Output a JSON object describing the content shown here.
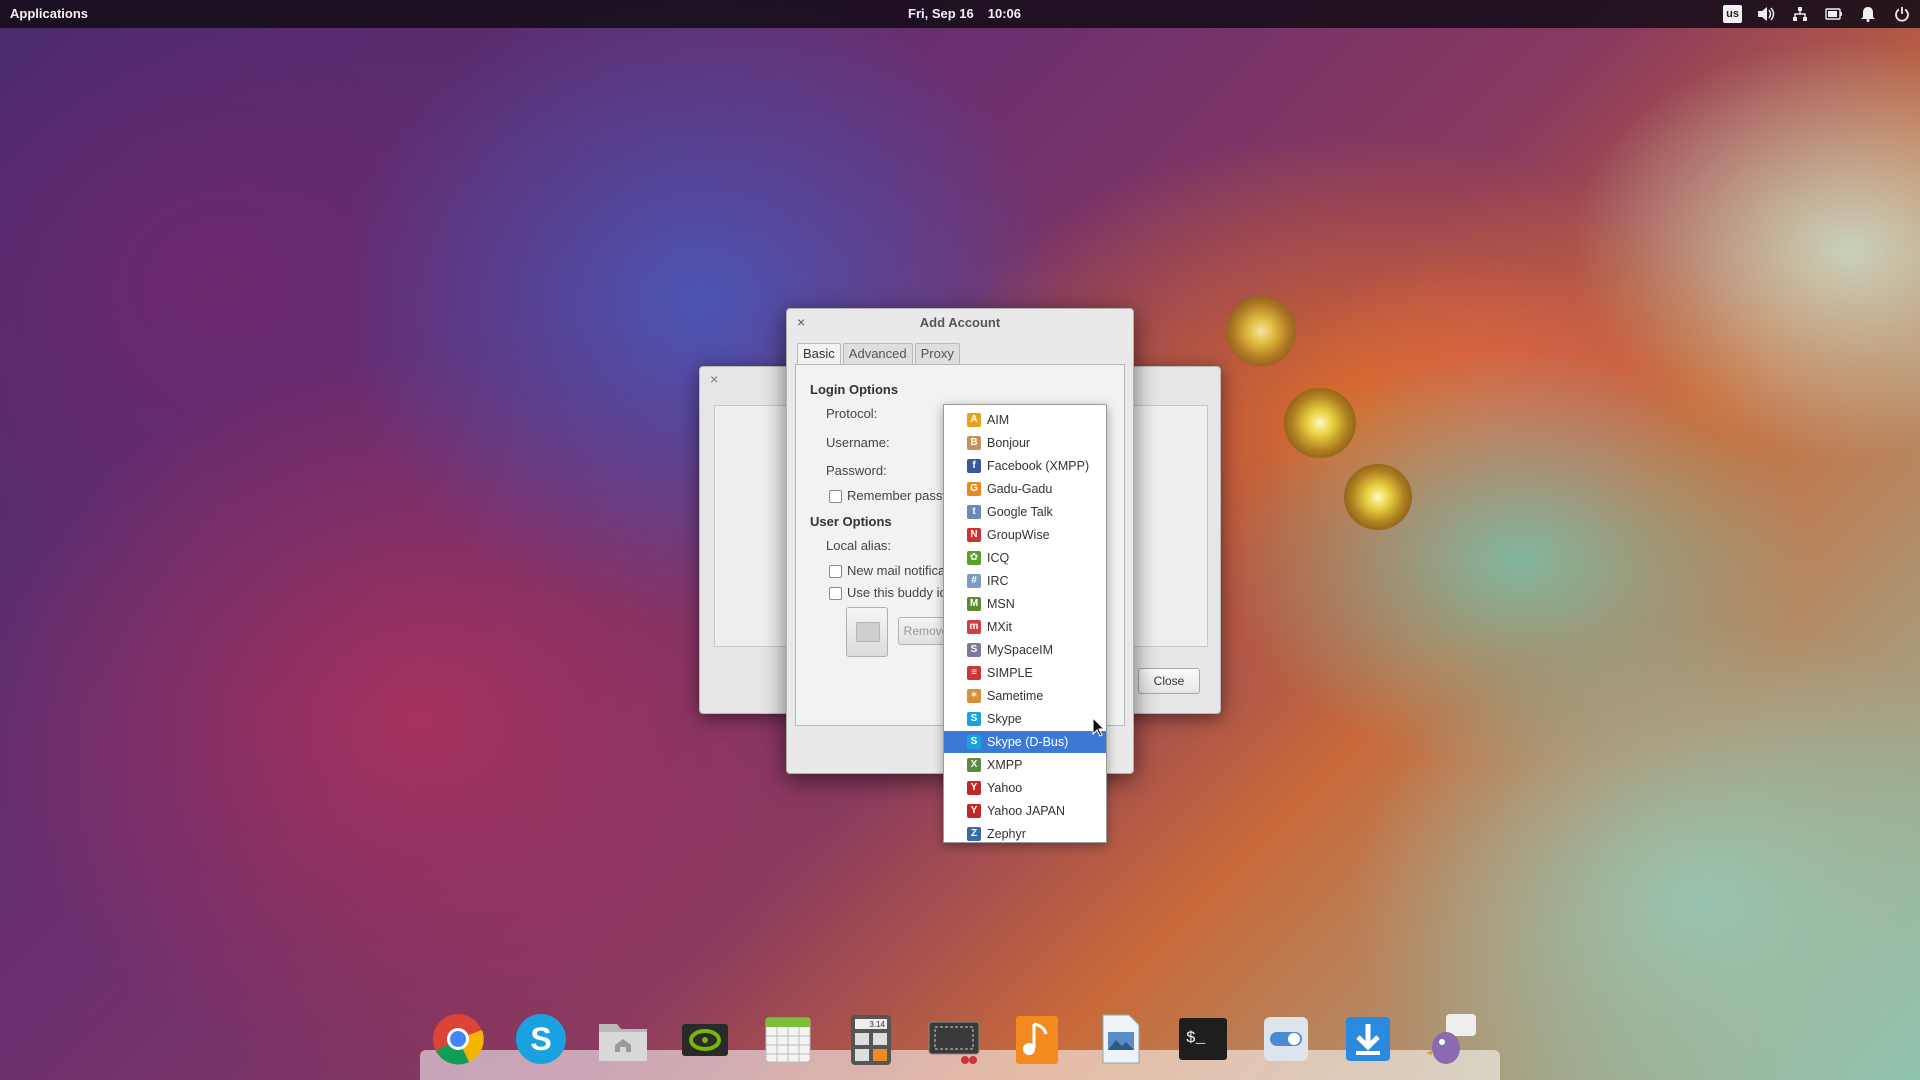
{
  "top_panel": {
    "applications_label": "Applications",
    "date": "Fri, Sep 16",
    "time": "10:06",
    "keyboard_layout": "us",
    "tray_icons": [
      "volume-icon",
      "network-icon",
      "battery-icon",
      "notifications-icon",
      "power-icon"
    ]
  },
  "background_dialog": {
    "close_glyph": "×",
    "remove_label": "Remove",
    "close_label": "Close"
  },
  "add_account": {
    "title": "Add Account",
    "close_glyph": "×",
    "tabs": [
      {
        "label": "Basic",
        "active": true
      },
      {
        "label": "Advanced",
        "active": false
      },
      {
        "label": "Proxy",
        "active": false
      }
    ],
    "login_options_title": "Login Options",
    "protocol_label": "Protocol:",
    "username_label": "Username:",
    "password_label": "Password:",
    "remember_password_label": "Remember passw",
    "user_options_title": "User Options",
    "local_alias_label": "Local alias:",
    "new_mail_label": "New mail notifica",
    "buddy_icon_label": "Use this buddy ic"
  },
  "protocol_dropdown": {
    "items": [
      {
        "label": "AIM",
        "icon": "aim-icon",
        "color": "#e8a020",
        "glyph": "A"
      },
      {
        "label": "Bonjour",
        "icon": "bonjour-icon",
        "color": "#c8905a",
        "glyph": "B"
      },
      {
        "label": "Facebook (XMPP)",
        "icon": "facebook-icon",
        "color": "#3b5998",
        "glyph": "f"
      },
      {
        "label": "Gadu-Gadu",
        "icon": "gadu-gadu-icon",
        "color": "#e88820",
        "glyph": "G"
      },
      {
        "label": "Google Talk",
        "icon": "google-talk-icon",
        "color": "#6a8ab8",
        "glyph": "t"
      },
      {
        "label": "GroupWise",
        "icon": "groupwise-icon",
        "color": "#d03030",
        "glyph": "N"
      },
      {
        "label": "ICQ",
        "icon": "icq-icon",
        "color": "#58a028",
        "glyph": "✿"
      },
      {
        "label": "IRC",
        "icon": "irc-icon",
        "color": "#7a9ac8",
        "glyph": "#"
      },
      {
        "label": "MSN",
        "icon": "msn-icon",
        "color": "#5a8a30",
        "glyph": "M"
      },
      {
        "label": "MXit",
        "icon": "mxit-icon",
        "color": "#d04040",
        "glyph": "m"
      },
      {
        "label": "MySpaceIM",
        "icon": "myspaceim-icon",
        "color": "#7a7a9a",
        "glyph": "S"
      },
      {
        "label": "SIMPLE",
        "icon": "simple-icon",
        "color": "#c83838",
        "glyph": "≡"
      },
      {
        "label": "Sametime",
        "icon": "sametime-icon",
        "color": "#d89038",
        "glyph": "✶"
      },
      {
        "label": "Skype",
        "icon": "skype-icon",
        "color": "#1aa2e0",
        "glyph": "S"
      },
      {
        "label": "Skype (D-Bus)",
        "icon": "skype-dbus-icon",
        "color": "#1aa2e0",
        "glyph": "S"
      },
      {
        "label": "XMPP",
        "icon": "xmpp-icon",
        "color": "#5a8a40",
        "glyph": "X"
      },
      {
        "label": "Yahoo",
        "icon": "yahoo-icon",
        "color": "#c02828",
        "glyph": "Y"
      },
      {
        "label": "Yahoo JAPAN",
        "icon": "yahoo-japan-icon",
        "color": "#c02828",
        "glyph": "Y"
      },
      {
        "label": "Zephyr",
        "icon": "zephyr-icon",
        "color": "#3a6aa8",
        "glyph": "Z"
      }
    ],
    "selected": "Skype (D-Bus)",
    "highlight_color": "#3a7ad4"
  },
  "dock": {
    "apps": [
      {
        "name": "chrome-icon"
      },
      {
        "name": "skype-icon"
      },
      {
        "name": "files-icon"
      },
      {
        "name": "nvidia-icon"
      },
      {
        "name": "spreadsheet-icon"
      },
      {
        "name": "calculator-icon",
        "text": "3.14"
      },
      {
        "name": "screenshot-icon"
      },
      {
        "name": "music-icon"
      },
      {
        "name": "image-viewer-icon"
      },
      {
        "name": "terminal-icon",
        "text": "$_"
      },
      {
        "name": "settings-icon"
      },
      {
        "name": "downloads-icon"
      },
      {
        "name": "pidgin-icon"
      }
    ]
  }
}
